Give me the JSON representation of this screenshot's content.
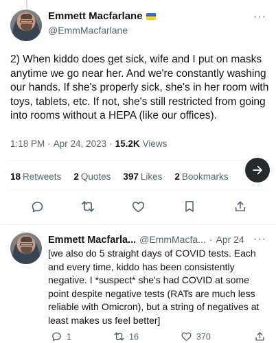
{
  "tweet": {
    "author_name": "Emmett Macfarlane",
    "author_handle": "@EmmMacfarlane",
    "more_label": "···",
    "body": "2) When kiddo does get sick, wife and I put on masks anytime we go near her. And we're constantly washing our hands. If she's properly sick, she's in her room with toys, tablets, etc. If not, she's still restricted from going into rooms without a HEPA (like our offices).",
    "time": "1:18 PM",
    "separator": "·",
    "date": "Apr 24, 2023",
    "views_count": "15.2K",
    "views_label": "Views"
  },
  "stats": {
    "retweets_count": "18",
    "retweets_label": "Retweets",
    "quotes_count": "2",
    "quotes_label": "Quotes",
    "likes_count": "397",
    "likes_label": "Likes",
    "bookmarks_count": "2",
    "bookmarks_label": "Bookmarks"
  },
  "icons": {
    "reply": "reply-icon",
    "retweet": "retweet-icon",
    "like": "heart-icon",
    "bookmark": "bookmark-icon",
    "share": "share-icon",
    "next": "arrow-right-icon",
    "verified_flag": "ukraine-flag-icon"
  },
  "reply": {
    "author_name": "Emmett Macfarla...",
    "author_handle": "@EmmMacfa...",
    "separator": "·",
    "date": "Apr 24",
    "more_label": "···",
    "body": "[we also do 5 straight days of COVID tests. Each and every time, kiddo has been consistently negative. I *suspect* she's had COVID at some point despite negative tests (RATs are much less reliable with Omicron), but a string of negatives at least makes us feel better]",
    "reply_count": "1",
    "retweet_count": "16",
    "like_count": "370"
  },
  "colors": {
    "text": "#0f1419",
    "secondary": "#536471",
    "divider": "#eff3f4",
    "fab": "#262a2d"
  }
}
